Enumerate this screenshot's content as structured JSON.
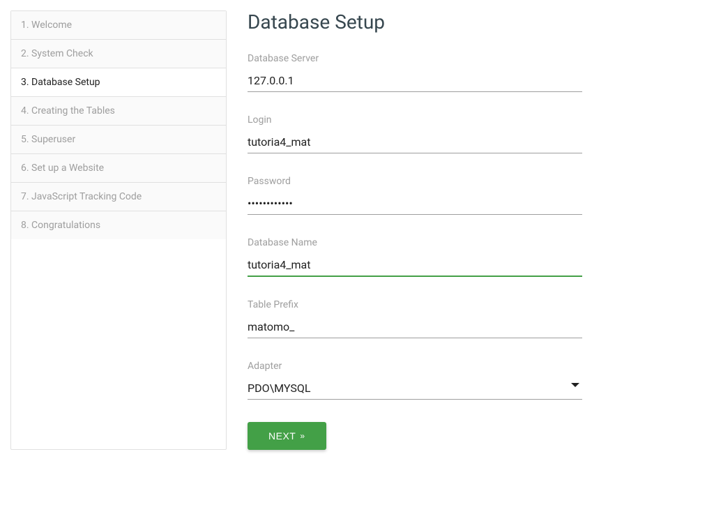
{
  "sidebar": {
    "items": [
      {
        "label": "1. Welcome",
        "active": false
      },
      {
        "label": "2. System Check",
        "active": false
      },
      {
        "label": "3. Database Setup",
        "active": true
      },
      {
        "label": "4. Creating the Tables",
        "active": false
      },
      {
        "label": "5. Superuser",
        "active": false
      },
      {
        "label": "6. Set up a Website",
        "active": false
      },
      {
        "label": "7. JavaScript Tracking Code",
        "active": false
      },
      {
        "label": "8. Congratulations",
        "active": false
      }
    ]
  },
  "main": {
    "title": "Database Setup",
    "fields": {
      "db_server": {
        "label": "Database Server",
        "value": "127.0.0.1"
      },
      "login": {
        "label": "Login",
        "value": "tutoria4_mat"
      },
      "password": {
        "label": "Password",
        "value": "••••••••••••"
      },
      "db_name": {
        "label": "Database Name",
        "value": "tutoria4_mat"
      },
      "table_prefix": {
        "label": "Table Prefix",
        "value": "matomo_"
      },
      "adapter": {
        "label": "Adapter",
        "value": "PDO\\MYSQL"
      }
    },
    "button": {
      "label": "NEXT",
      "arrow": "»"
    }
  }
}
